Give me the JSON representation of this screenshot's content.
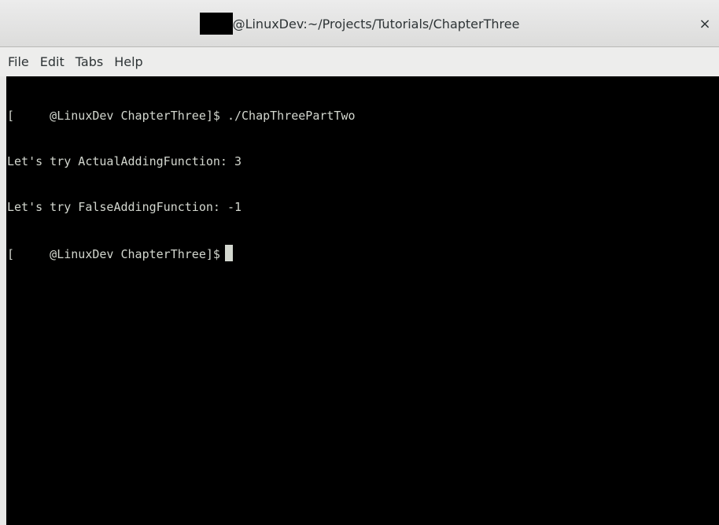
{
  "window": {
    "title": "@LinuxDev:~/Projects/Tutorials/ChapterThree",
    "close_symbol": "×",
    "title_redaction_color": "#000000"
  },
  "menu": {
    "items": [
      {
        "label": "File"
      },
      {
        "label": "Edit"
      },
      {
        "label": "Tabs"
      },
      {
        "label": "Help"
      }
    ]
  },
  "terminal": {
    "background": "#000000",
    "foreground": "#d3d7cf",
    "lines": [
      "[     @LinuxDev ChapterThree]$ ./ChapThreePartTwo",
      "Let's try ActualAddingFunction: 3",
      "Let's try FalseAddingFunction: -1"
    ],
    "prompt": "[     @LinuxDev ChapterThree]$"
  },
  "icons": {
    "close": "close-icon"
  }
}
